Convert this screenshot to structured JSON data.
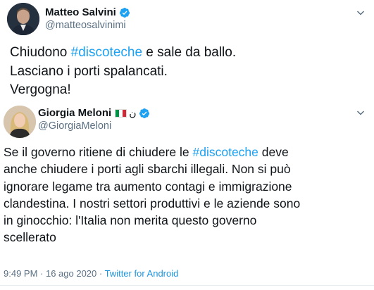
{
  "tweets": [
    {
      "author_name": "Matteo Salvini",
      "handle": "@matteosalvinimi",
      "verified": true,
      "text_parts": [
        {
          "text": "Chiudono ",
          "hashtag": false
        },
        {
          "text": "#discoteche",
          "hashtag": true
        },
        {
          "text": " e sale da ballo.\nLasciano i porti spalancati.\nVergogna!",
          "hashtag": false
        }
      ]
    },
    {
      "author_name": "Giorgia Meloni",
      "name_suffix": "ن",
      "handle": "@GiorgiaMeloni",
      "verified": true,
      "flag_colors": [
        "#009246",
        "#ffffff",
        "#ce2b37"
      ],
      "text_parts": [
        {
          "text": "Se il governo ritiene di chiudere le ",
          "hashtag": false
        },
        {
          "text": "#discoteche",
          "hashtag": true
        },
        {
          "text": " deve\nanche chiudere i porti agli sbarchi illegali. Non si può\nignorare legame tra aumento contagi e immigrazione\nclandestina. I nostri settori produttivi e le aziende sono\nin ginocchio: l'Italia non merita questo governo\nscellerato",
          "hashtag": false
        }
      ],
      "timestamp": "9:49 PM · 16 ago 2020 · ",
      "source": "Twitter for Android"
    }
  ],
  "colors": {
    "hashtag": "#1da1f2",
    "verified": "#1da1f2",
    "secondary_text": "#5b7083"
  },
  "icons": {
    "verified": "verified-badge-icon",
    "caret": "chevron-down-icon",
    "flag": "italy-flag-icon"
  }
}
